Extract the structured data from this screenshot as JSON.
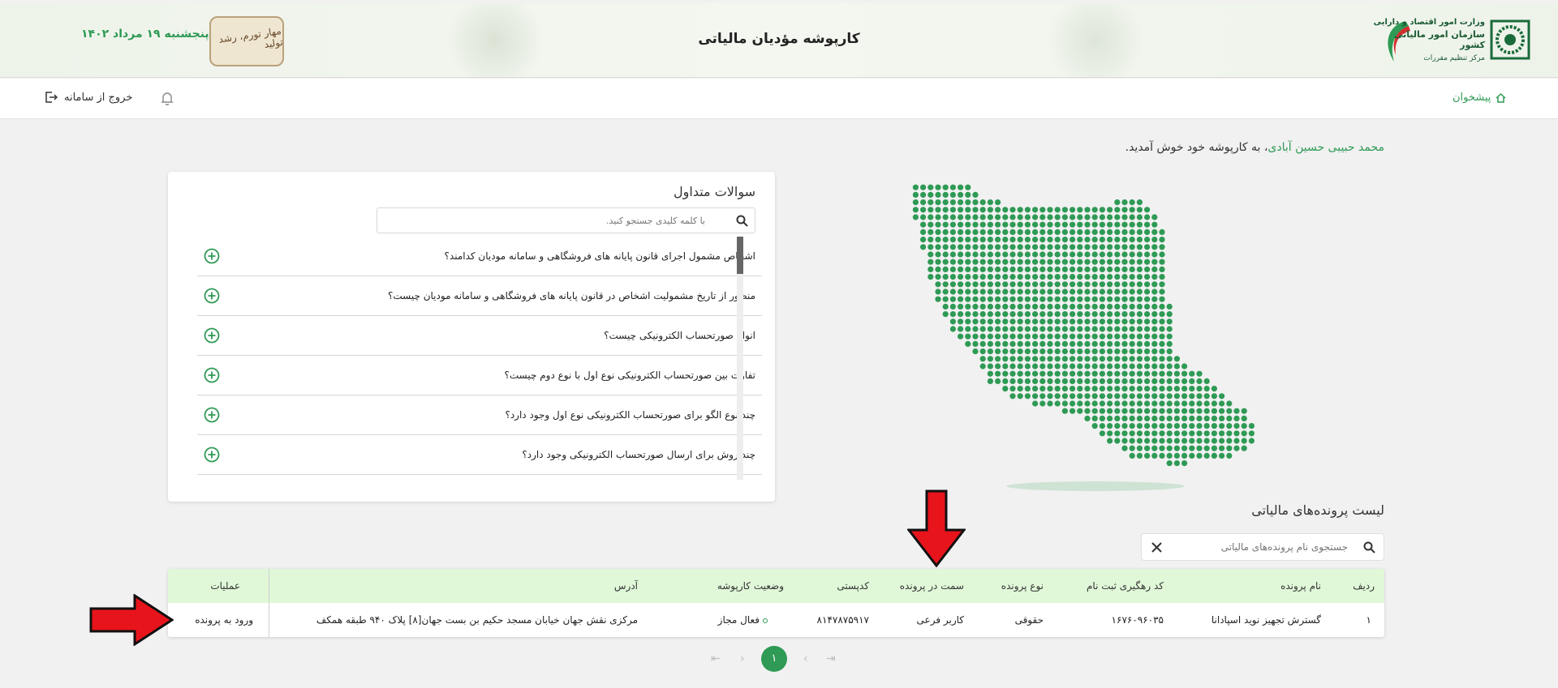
{
  "header": {
    "title": "کارپوشه مؤدیان مالیاتی",
    "date": "پنجشنبه ۱۹ مرداد ۱۴۰۲",
    "emblem_text": "مهار تورم، رشد تولید",
    "org": {
      "line1": "وزارت امور اقتصاد و دارایی",
      "line2": "سازمان امور مالیاتی کشور",
      "line3": "مرکز تنظیم مقررات"
    }
  },
  "subbar": {
    "home_label": "پیشخوان",
    "logout_label": "خروج از سامانه"
  },
  "welcome": {
    "name": "محمد حبیبی حسین آبادی",
    "suffix": "، به کارپوشه خود خوش آمدید."
  },
  "faq": {
    "title": "سوالات متداول",
    "search_placeholder": "با کلمه کلیدی جستجو کنید.",
    "items": [
      "اشخاص مشمول اجرای قانون پایانه های فروشگاهی و سامانه مودیان کدامند؟",
      "منظور از تاریخ مشمولیت اشخاص در قانون پایانه های فروشگاهی و سامانه مودیان چیست؟",
      "انواع صورتحساب الکترونیکی چیست؟",
      "تفاوت بین صورتحساب الکترونیکی نوع اول با نوع دوم چیست؟",
      "چند نوع الگو برای صورتحساب الکترونیکی نوع اول وجود دارد؟",
      "چند روش برای ارسال صورتحساب الکترونیکی وجود دارد؟"
    ]
  },
  "files": {
    "title": "لیست پرونده‌های مالیاتی",
    "search_placeholder": "جستجوی نام پرونده‌های مالیاتی",
    "columns": {
      "row": "ردیف",
      "name": "نام پرونده",
      "tracking": "کد رهگیری ثبت نام",
      "type": "نوع پرونده",
      "role": "سمت در پرونده",
      "postal": "کدپستی",
      "status": "وضعیت کارپوشه",
      "address": "آدرس",
      "ops": "عملیات"
    },
    "rows": [
      {
        "row": "۱",
        "name": "گسترش تجهیز نوید اسپادانا",
        "tracking": "۱۶۷۶۰۹۶۰۳۵",
        "type": "حقوقی",
        "role": "کاربر فرعی",
        "postal": "۸۱۴۷۸۷۵۹۱۷",
        "status": "فعال مجاز",
        "address": "مرکزی نقش جهان خیابان مسجد حکیم بن بست جهان[۸] پلاک ۹۴۰ طبقه همکف",
        "action": "ورود به پرونده"
      }
    ]
  },
  "pagination": {
    "current": "۱"
  },
  "colors": {
    "primary_green": "#2e9a55",
    "table_header_bg": "#e0f8d8",
    "arrow_red": "#e8141c"
  }
}
